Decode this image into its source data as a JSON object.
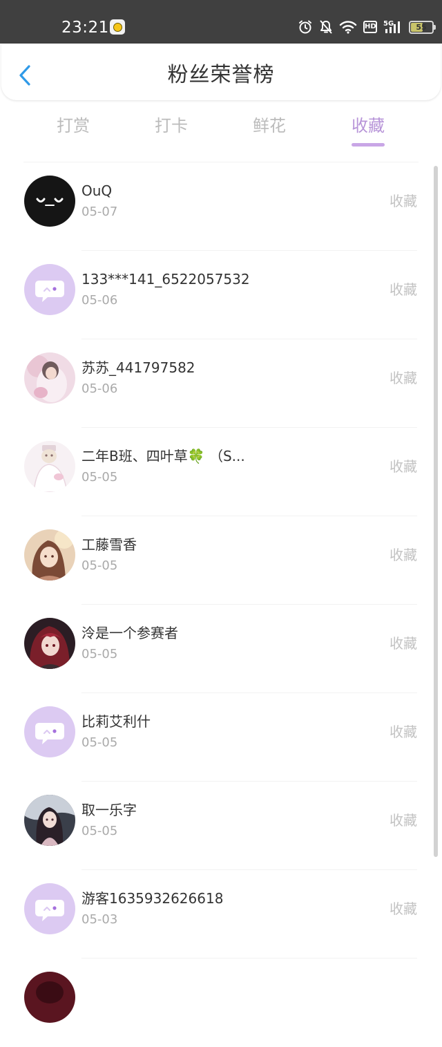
{
  "status_bar": {
    "time": "23:21",
    "network": "5G",
    "hd_label": "HD",
    "battery_percent": "55",
    "battery_level": 0.55
  },
  "header": {
    "title": "粉丝荣誉榜",
    "back_icon": "chevron-left-icon"
  },
  "tabs": [
    {
      "label": "打赏",
      "active": false
    },
    {
      "label": "打卡",
      "active": false
    },
    {
      "label": "鲜花",
      "active": false
    },
    {
      "label": "收藏",
      "active": true
    }
  ],
  "colors": {
    "accent": "#b794d8",
    "tab_inactive": "#bbbbbb",
    "status_bar_bg": "#404040",
    "default_avatar_bg": "#dccaf2"
  },
  "fans": [
    {
      "name": "OuQ",
      "date": "05-07",
      "action": "收藏",
      "avatar": "black-face-avatar"
    },
    {
      "name": "133***141_6522057532",
      "date": "05-06",
      "action": "收藏",
      "avatar": "default-chat-avatar"
    },
    {
      "name": "苏苏_441797582",
      "date": "05-06",
      "action": "收藏",
      "avatar": "pink-photo-avatar"
    },
    {
      "name": "二年B班、四叶草🍀 （S...",
      "date": "05-05",
      "action": "收藏",
      "avatar": "white-anime-avatar"
    },
    {
      "name": "工藤雪香",
      "date": "05-05",
      "action": "收藏",
      "avatar": "warm-anime-avatar"
    },
    {
      "name": "泠是一个参赛者",
      "date": "05-05",
      "action": "收藏",
      "avatar": "dark-red-anime-avatar"
    },
    {
      "name": "比莉艾利什",
      "date": "05-05",
      "action": "收藏",
      "avatar": "default-chat-avatar"
    },
    {
      "name": "取一乐字",
      "date": "05-05",
      "action": "收藏",
      "avatar": "dark-anime-avatar"
    },
    {
      "name": "游客1635932626618",
      "date": "05-03",
      "action": "收藏",
      "avatar": "default-chat-avatar"
    },
    {
      "name": "",
      "date": "",
      "action": "",
      "avatar": "partial-red-avatar"
    }
  ]
}
